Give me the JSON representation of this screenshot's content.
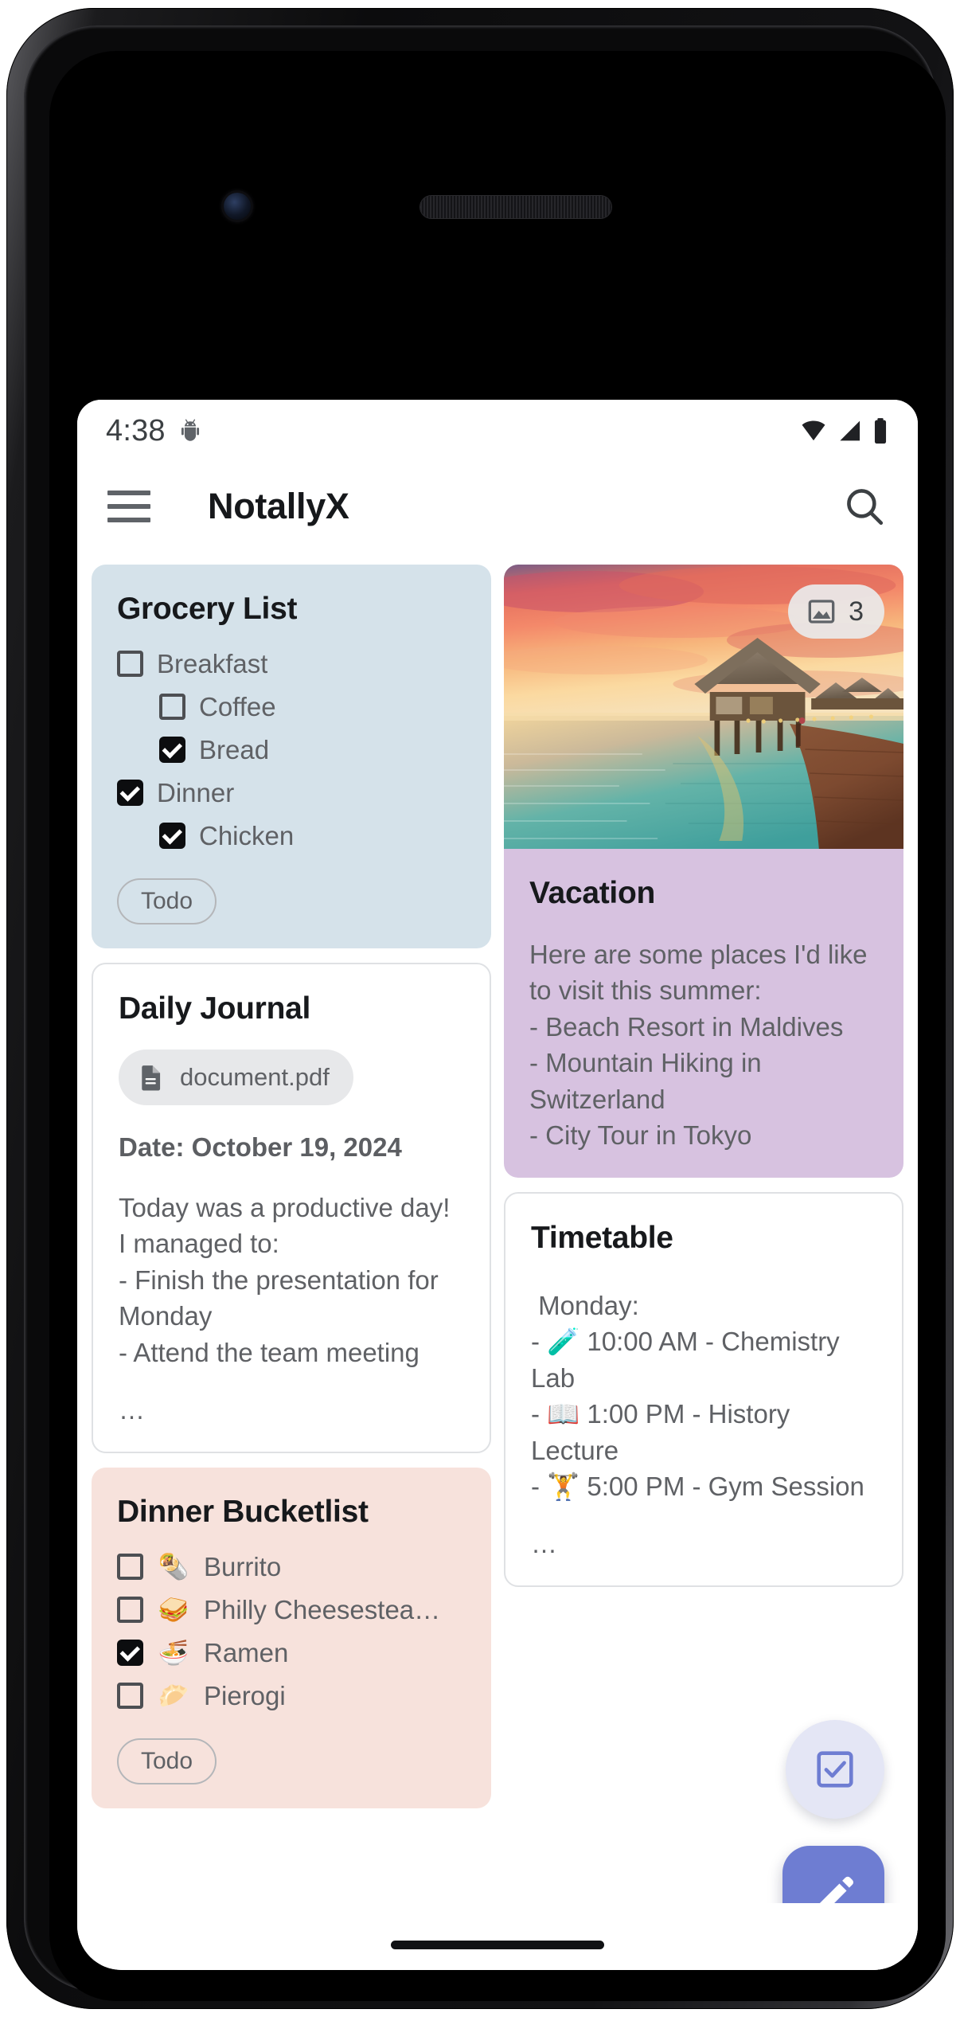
{
  "status_bar": {
    "time": "4:38",
    "icons": [
      "android-bug-icon",
      "wifi-icon",
      "signal-icon",
      "battery-icon"
    ]
  },
  "toolbar": {
    "menu_icon": "hamburger-menu-icon",
    "title": "NotallyX",
    "search_icon": "search-icon"
  },
  "notes": {
    "grocery_list": {
      "title": "Grocery List",
      "background": "#d5e2ea",
      "items": [
        {
          "label": "Breakfast",
          "checked": false,
          "indent": false
        },
        {
          "label": "Coffee",
          "checked": false,
          "indent": true
        },
        {
          "label": "Bread",
          "checked": true,
          "indent": true
        },
        {
          "label": "Dinner",
          "checked": true,
          "indent": false
        },
        {
          "label": "Chicken",
          "checked": true,
          "indent": true
        }
      ],
      "label_chip": "Todo"
    },
    "daily_journal": {
      "title": "Daily Journal",
      "background": "#ffffff",
      "attachment": {
        "icon": "document-file-icon",
        "name": "document.pdf"
      },
      "date_line": "Date: October 19, 2024",
      "body": "Today was a productive day! I managed to:\n- Finish the presentation for Monday\n- Attend the team meeting",
      "more_indicator": "…"
    },
    "dinner_bucketlist": {
      "title": "Dinner Bucketlist",
      "background": "#f7e2dc",
      "items": [
        {
          "emoji": "🌯",
          "label": "Burrito",
          "checked": false
        },
        {
          "emoji": "🥪",
          "label": "Philly Cheesestea…",
          "checked": false
        },
        {
          "emoji": "🍜",
          "label": "Ramen",
          "checked": true
        },
        {
          "emoji": "🥟",
          "label": "Pierogi",
          "checked": false
        }
      ],
      "label_chip": "Todo"
    },
    "vacation": {
      "title": "Vacation",
      "background": "#d7c2e0",
      "image_badge": {
        "icon": "image-icon",
        "count": "3"
      },
      "image_alt": "overwater-bungalows-sunset-photo",
      "body": "Here are some places I'd like to visit this summer:\n- Beach Resort in Maldives\n- Mountain Hiking in Switzerland\n- City Tour in Tokyo"
    },
    "timetable": {
      "title": "Timetable",
      "background": "#ffffff",
      "body": " Monday:\n- 🧪 10:00 AM - Chemistry Lab\n- 📖 1:00 PM - History Lecture\n- 🏋️ 5:00 PM - Gym Session",
      "more_indicator": "…"
    }
  },
  "fabs": {
    "todo_fab": {
      "icon": "checkbox-checked-icon",
      "color": "#6e7dd2"
    },
    "note_fab": {
      "icon": "pencil-edit-icon",
      "color": "#6e7dd2"
    }
  }
}
